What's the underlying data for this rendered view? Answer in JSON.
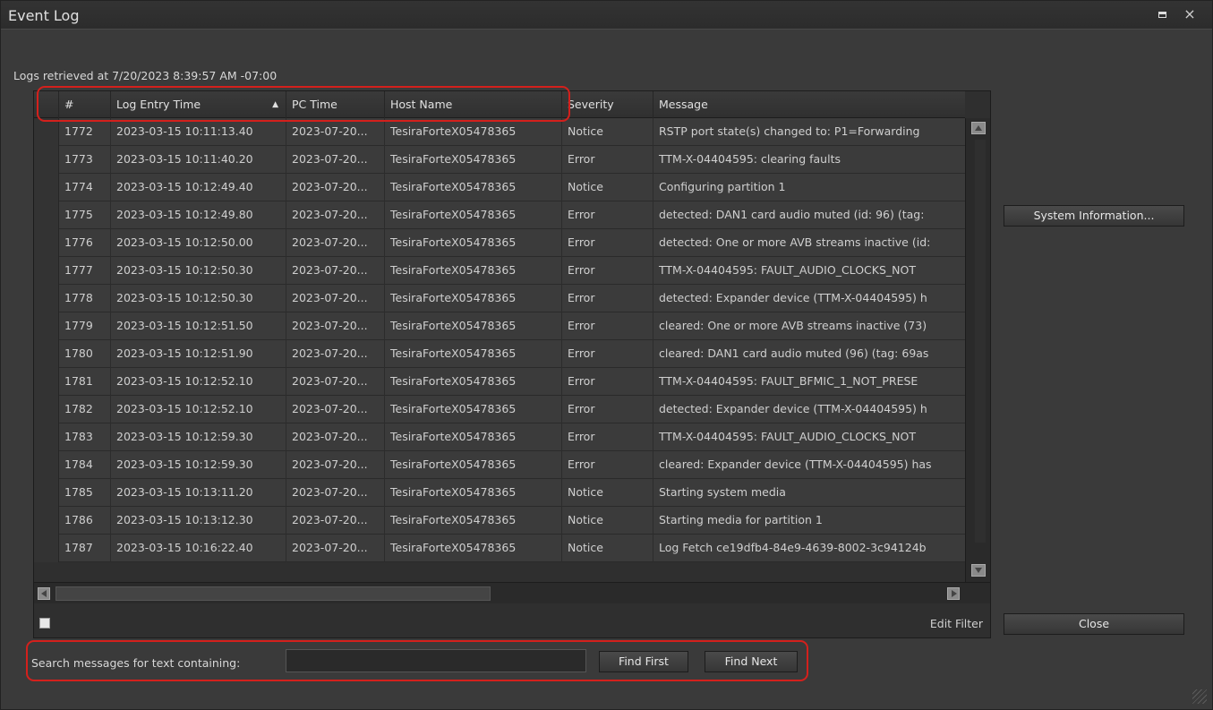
{
  "window": {
    "title": "Event Log",
    "maximize_label": "",
    "close_label": "×"
  },
  "retrieved_text": "Logs retrieved at 7/20/2023 8:39:57 AM -07:00",
  "table": {
    "columns": [
      "#",
      "Log Entry Time",
      "PC Time",
      "Host Name",
      "Severity",
      "Message"
    ],
    "sort_column": "Log Entry Time",
    "sort_arrow": "▲",
    "rows": [
      [
        "1772",
        "2023-03-15 10:11:13.40",
        "2023-07-20...",
        "TesiraForteX05478365",
        "Notice",
        "RSTP port state(s) changed to:  P1=Forwarding"
      ],
      [
        "1773",
        "2023-03-15 10:11:40.20",
        "2023-07-20...",
        "TesiraForteX05478365",
        "Error",
        "TTM-X-04404595: clearing faults"
      ],
      [
        "1774",
        "2023-03-15 10:12:49.40",
        "2023-07-20...",
        "TesiraForteX05478365",
        "Notice",
        "Configuring partition 1"
      ],
      [
        "1775",
        "2023-03-15 10:12:49.80",
        "2023-07-20...",
        "TesiraForteX05478365",
        "Error",
        "detected: DAN1 card audio muted (id: 96) (tag:"
      ],
      [
        "1776",
        "2023-03-15 10:12:50.00",
        "2023-07-20...",
        "TesiraForteX05478365",
        "Error",
        "detected: One or more AVB streams inactive (id:"
      ],
      [
        "1777",
        "2023-03-15 10:12:50.30",
        "2023-07-20...",
        "TesiraForteX05478365",
        "Error",
        "TTM-X-04404595: FAULT_AUDIO_CLOCKS_NOT"
      ],
      [
        "1778",
        "2023-03-15 10:12:50.30",
        "2023-07-20...",
        "TesiraForteX05478365",
        "Error",
        "detected: Expander device (TTM-X-04404595) h"
      ],
      [
        "1779",
        "2023-03-15 10:12:51.50",
        "2023-07-20...",
        "TesiraForteX05478365",
        "Error",
        "cleared: One or more AVB streams inactive (73)"
      ],
      [
        "1780",
        "2023-03-15 10:12:51.90",
        "2023-07-20...",
        "TesiraForteX05478365",
        "Error",
        "cleared: DAN1 card audio muted (96) (tag: 69as"
      ],
      [
        "1781",
        "2023-03-15 10:12:52.10",
        "2023-07-20...",
        "TesiraForteX05478365",
        "Error",
        "TTM-X-04404595: FAULT_BFMIC_1_NOT_PRESE"
      ],
      [
        "1782",
        "2023-03-15 10:12:52.10",
        "2023-07-20...",
        "TesiraForteX05478365",
        "Error",
        "detected: Expander device (TTM-X-04404595) h"
      ],
      [
        "1783",
        "2023-03-15 10:12:59.30",
        "2023-07-20...",
        "TesiraForteX05478365",
        "Error",
        "TTM-X-04404595: FAULT_AUDIO_CLOCKS_NOT"
      ],
      [
        "1784",
        "2023-03-15 10:12:59.30",
        "2023-07-20...",
        "TesiraForteX05478365",
        "Error",
        "cleared: Expander device (TTM-X-04404595) has"
      ],
      [
        "1785",
        "2023-03-15 10:13:11.20",
        "2023-07-20...",
        "TesiraForteX05478365",
        "Notice",
        "Starting system media"
      ],
      [
        "1786",
        "2023-03-15 10:13:12.30",
        "2023-07-20...",
        "TesiraForteX05478365",
        "Notice",
        "Starting media for partition 1"
      ],
      [
        "1787",
        "2023-03-15 10:16:22.40",
        "2023-07-20...",
        "TesiraForteX05478365",
        "Notice",
        "Log Fetch ce19dfb4-84e9-4639-8002-3c94124b"
      ]
    ]
  },
  "edit_filter_label": "Edit Filter",
  "buttons": {
    "system_information": "System Information...",
    "close": "Close",
    "find_first": "Find First",
    "find_next": "Find Next"
  },
  "search": {
    "label": "Search messages for text containing:",
    "value": ""
  },
  "colors": {
    "highlight": "#d4201c",
    "window_bg": "#3a3a3a"
  }
}
